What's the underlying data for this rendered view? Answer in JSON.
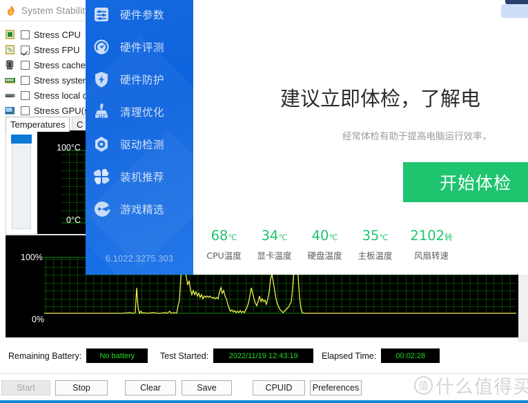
{
  "window": {
    "title": "System Stability",
    "title_icon": "flame-icon"
  },
  "stress_options": [
    {
      "label": "Stress CPU",
      "checked": false,
      "icon": "cpu-chip-icon"
    },
    {
      "label": "Stress FPU",
      "checked": true,
      "icon": "fpu-chip-icon"
    },
    {
      "label": "Stress cache",
      "checked": false,
      "icon": "cache-chip-icon"
    },
    {
      "label": "Stress system",
      "checked": false,
      "icon": "memory-module-icon"
    },
    {
      "label": "Stress local d",
      "checked": false,
      "icon": "hard-disk-icon"
    },
    {
      "label": "Stress GPU(s",
      "checked": false,
      "icon": "gpu-card-icon"
    }
  ],
  "tabs": [
    {
      "label": "Temperatures",
      "active": true
    },
    {
      "label": "C",
      "active": false
    }
  ],
  "temperature_chart": {
    "top_label": "100°C",
    "bottom_label": "0°C",
    "grid_color": "#0a8a0a",
    "background": "#000000"
  },
  "usage_chart": {
    "top_label": "100%",
    "bottom_label": "0%",
    "grid_color": "#0a8a0a",
    "line_color": "#f3f34b",
    "background": "#000000"
  },
  "status": [
    {
      "label": "Remaining Battery:",
      "value": "No battery"
    },
    {
      "label": "Test Started:",
      "value": "2022/11/19 12:43:19"
    },
    {
      "label": "Elapsed Time:",
      "value": "00:02:28"
    }
  ],
  "buttons": [
    {
      "label": "Start",
      "disabled": true
    },
    {
      "label": "Stop",
      "disabled": false
    },
    {
      "label": "Clear",
      "disabled": false
    },
    {
      "label": "Save",
      "disabled": false
    },
    {
      "label": "CPUID",
      "disabled": false
    },
    {
      "label": "Preferences",
      "disabled": false
    }
  ],
  "overlay": {
    "menu": [
      {
        "label": "硬件参数",
        "icon": "sliders-icon"
      },
      {
        "label": "硬件评测",
        "icon": "gauge-icon"
      },
      {
        "label": "硬件防护",
        "icon": "shield-bolt-icon"
      },
      {
        "label": "清理优化",
        "icon": "broom-icon"
      },
      {
        "label": "驱动检测",
        "icon": "hex-gear-icon"
      },
      {
        "label": "装机推荐",
        "icon": "four-squares-icon"
      },
      {
        "label": "游戏精选",
        "icon": "game-pacman-icon"
      }
    ],
    "version": "6.1022.3275.303",
    "hero_title": "建议立即体检，了解电",
    "hero_subtitle": "经常体检有助于提高电脑运行效率，",
    "hero_button": "开始体检",
    "metrics": [
      {
        "value": "68",
        "unit": "℃",
        "name": "CPU温度"
      },
      {
        "value": "34",
        "unit": "℃",
        "name": "显卡温度"
      },
      {
        "value": "40",
        "unit": "℃",
        "name": "硬盘温度"
      },
      {
        "value": "35",
        "unit": "℃",
        "name": "主板温度"
      },
      {
        "value": "2102",
        "unit": "转",
        "name": "风扇转速"
      }
    ],
    "illustration": "monitor-magnifier-icon",
    "accent_blue": "#0d63de",
    "accent_green": "#1ec46e"
  },
  "watermark": {
    "mark": "值",
    "text": "什么值得买"
  }
}
